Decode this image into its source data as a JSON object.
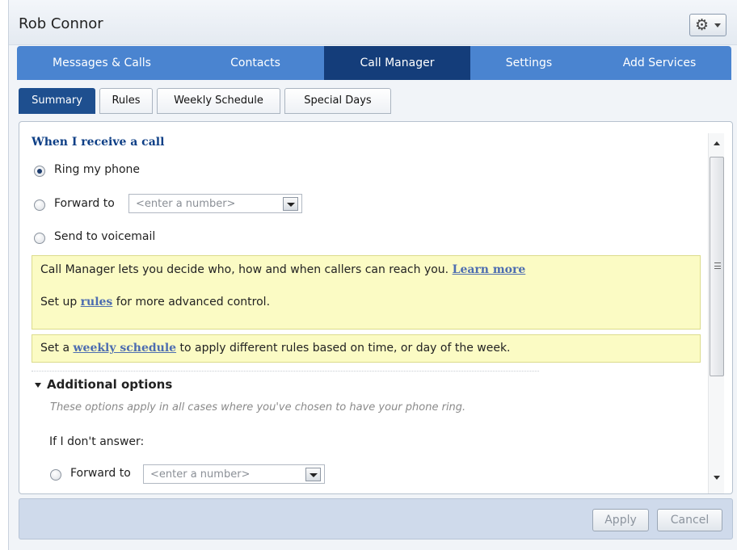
{
  "header": {
    "user_name": "Rob Connor",
    "settings_icon": "gear-icon"
  },
  "nav": {
    "items": [
      {
        "label": "Messages & Calls",
        "active": false
      },
      {
        "label": "Contacts",
        "active": false
      },
      {
        "label": "Call Manager",
        "active": true
      },
      {
        "label": "Settings",
        "active": false
      },
      {
        "label": "Add Services",
        "active": false
      }
    ]
  },
  "subtabs": [
    {
      "label": "Summary",
      "active": true
    },
    {
      "label": "Rules",
      "active": false
    },
    {
      "label": "Weekly Schedule",
      "active": false
    },
    {
      "label": "Special Days",
      "active": false
    }
  ],
  "call": {
    "heading": "When I receive a call",
    "options": [
      {
        "label": "Ring my phone",
        "checked": true
      },
      {
        "label": "Forward to",
        "checked": false
      },
      {
        "label": "Send to voicemail",
        "checked": false
      }
    ],
    "forward_placeholder": "<enter a number>"
  },
  "info": {
    "line1_text": "Call Manager lets you decide who, how and when callers can reach you.",
    "learn_more": "Learn more",
    "line2_prefix": "Set up",
    "rules_link": "rules",
    "line2_suffix": "for more advanced control.",
    "line3_prefix": "Set a",
    "schedule_link": "weekly schedule",
    "line3_suffix": "to apply different rules based on time, or day of the week."
  },
  "additional": {
    "title": "Additional options",
    "note": "These options apply in all cases where you've chosen to have your phone ring.",
    "if_no_answer": "If I don't answer:",
    "forward_label": "Forward to",
    "forward_placeholder": "<enter a number>",
    "forward_checked": false
  },
  "footer": {
    "apply": "Apply",
    "cancel": "Cancel"
  },
  "colors": {
    "nav_bg": "#4a84d0",
    "nav_active": "#143d7a",
    "heading": "#0e3f86",
    "info_bg": "#fbfbc4"
  }
}
